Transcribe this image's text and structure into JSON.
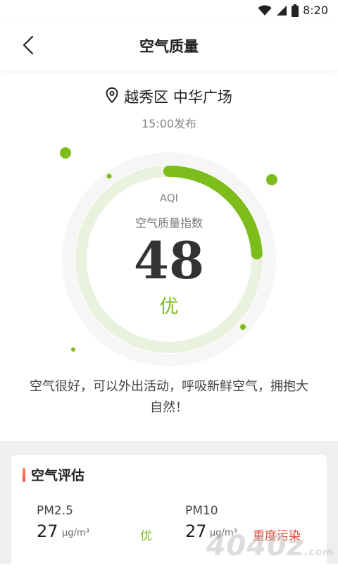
{
  "status_bar": {
    "time": "8:20",
    "icons": [
      "wifi-icon",
      "signal-icon",
      "battery-icon"
    ]
  },
  "header": {
    "title": "空气质量",
    "back_icon": "chevron-left-icon"
  },
  "location": {
    "icon": "location-pin-icon",
    "name": "越秀区 中华广场",
    "publish_time": "15:00发布"
  },
  "aqi": {
    "label": "AQI",
    "sublabel": "空气质量指数",
    "value": "48",
    "level": "优",
    "gauge_fraction": 0.24
  },
  "advice": {
    "text": "空气很好，可以外出活动，呼吸新鲜空气，拥抱大自然！"
  },
  "assessment": {
    "title": "空气评估",
    "items": [
      {
        "label": "PM2.5",
        "value": "27",
        "unit": "μg/m³",
        "level": "优"
      },
      {
        "label": "PM10",
        "value": "27",
        "unit": "μg/m³",
        "level": "重度污染"
      }
    ]
  },
  "watermark": {
    "text": "4040z",
    "suffix": ".com"
  },
  "colors": {
    "accent_green": "#7cbc1b",
    "ring_light": "#eaf2df",
    "ring_outer": "#f6f6f6",
    "danger_red": "#e8483a"
  }
}
